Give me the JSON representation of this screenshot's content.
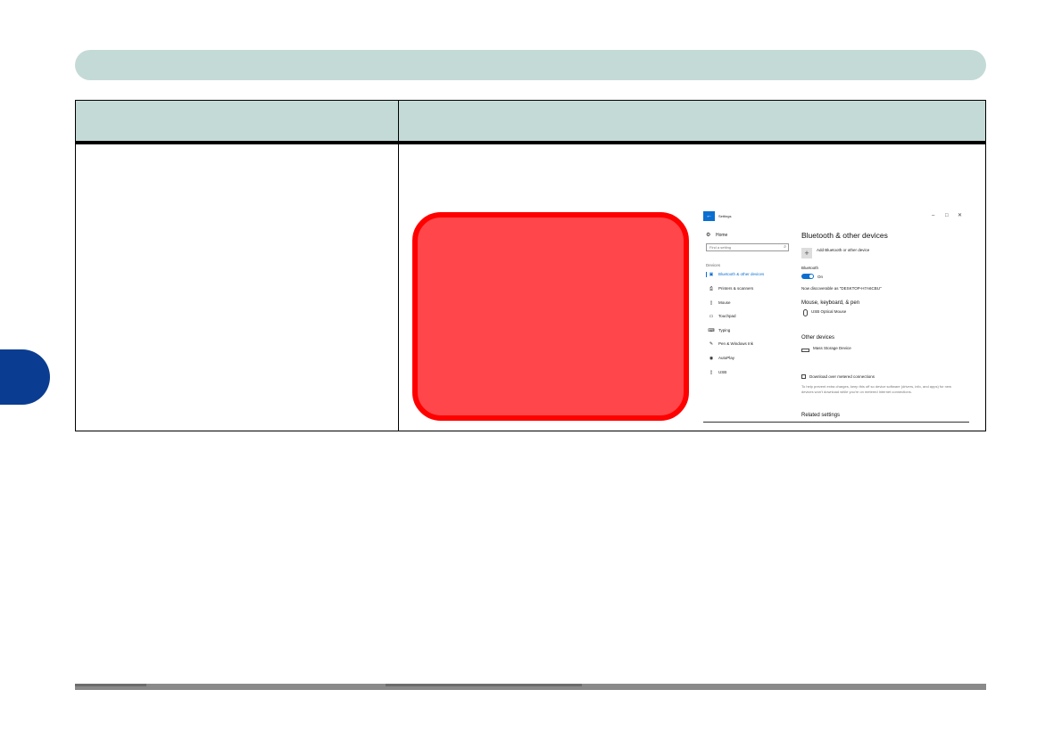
{
  "settings_window": {
    "title": "Settings",
    "back_glyph": "←",
    "controls": {
      "minimize": "–",
      "maximize": "□",
      "close": "✕"
    },
    "nav": {
      "home_label": "Home",
      "search_placeholder": "Find a setting",
      "section_label": "Devices",
      "items": [
        {
          "label": "Bluetooth & other devices",
          "icon": "bluetooth-devices-icon",
          "glyph": "▣",
          "active": true
        },
        {
          "label": "Printers & scanners",
          "icon": "printer-icon",
          "glyph": "⎙",
          "active": false
        },
        {
          "label": "Mouse",
          "icon": "mouse-icon",
          "glyph": "▯",
          "active": false
        },
        {
          "label": "Touchpad",
          "icon": "touchpad-icon",
          "glyph": "▭",
          "active": false
        },
        {
          "label": "Typing",
          "icon": "keyboard-icon",
          "glyph": "⌨",
          "active": false
        },
        {
          "label": "Pen & Windows Ink",
          "icon": "pen-icon",
          "glyph": "✎",
          "active": false
        },
        {
          "label": "AutoPlay",
          "icon": "autoplay-icon",
          "glyph": "◉",
          "active": false
        },
        {
          "label": "USB",
          "icon": "usb-icon",
          "glyph": "▯",
          "active": false
        }
      ]
    },
    "content": {
      "heading": "Bluetooth & other devices",
      "add_label": "Add Bluetooth or other device",
      "bluetooth_label": "Bluetooth",
      "toggle_state": "On",
      "discoverable_text": "Now discoverable as \"DESKTOP-H7A6CBU\"",
      "section_mouse": "Mouse, keyboard, & pen",
      "mouse_device": "USB Optical Mouse",
      "section_other": "Other devices",
      "storage_device": "Mass Storage Device",
      "metered_label": "Download over metered connections",
      "help_text": "To help prevent extra charges, keep this off so device software (drivers, info, and apps) for new devices won't download while you're on metered Internet connections.",
      "section_related": "Related settings"
    }
  },
  "colors": {
    "header_bar": "#c4dad6",
    "side_tab": "#0a3d91",
    "redaction_fill": "#ff474b",
    "redaction_border": "#ff0000",
    "accent": "#0b6fd0"
  }
}
